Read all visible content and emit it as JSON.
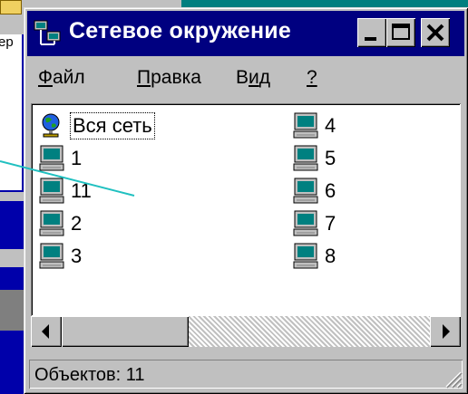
{
  "background": {
    "fragment_text": "ер"
  },
  "window": {
    "title": "Сетевое окружение",
    "title_icon": "network-neighborhood-icon",
    "caption_buttons": [
      "minimize",
      "maximize",
      "close"
    ],
    "colors": {
      "titlebar": "#000080",
      "face": "#c0c0c0",
      "content": "#ffffff",
      "desktop": "#0000aa"
    }
  },
  "menu": {
    "file": {
      "accel": "Ф",
      "rest": "айл"
    },
    "edit": {
      "accel": "П",
      "rest": "равка"
    },
    "view": {
      "pre": "В",
      "accel": "и",
      "rest": "д"
    },
    "help": {
      "accel": "?"
    }
  },
  "items": [
    {
      "label": "Вся сеть",
      "icon": "globe-icon"
    },
    {
      "label": "1",
      "icon": "computer-icon"
    },
    {
      "label": "11",
      "icon": "computer-icon"
    },
    {
      "label": "2",
      "icon": "computer-icon"
    },
    {
      "label": "3",
      "icon": "computer-icon"
    },
    {
      "label": "4",
      "icon": "computer-icon"
    },
    {
      "label": "5",
      "icon": "computer-icon"
    },
    {
      "label": "6",
      "icon": "computer-icon"
    },
    {
      "label": "7",
      "icon": "computer-icon"
    },
    {
      "label": "8",
      "icon": "computer-icon"
    }
  ],
  "status": {
    "text": "Объектов: 11"
  }
}
